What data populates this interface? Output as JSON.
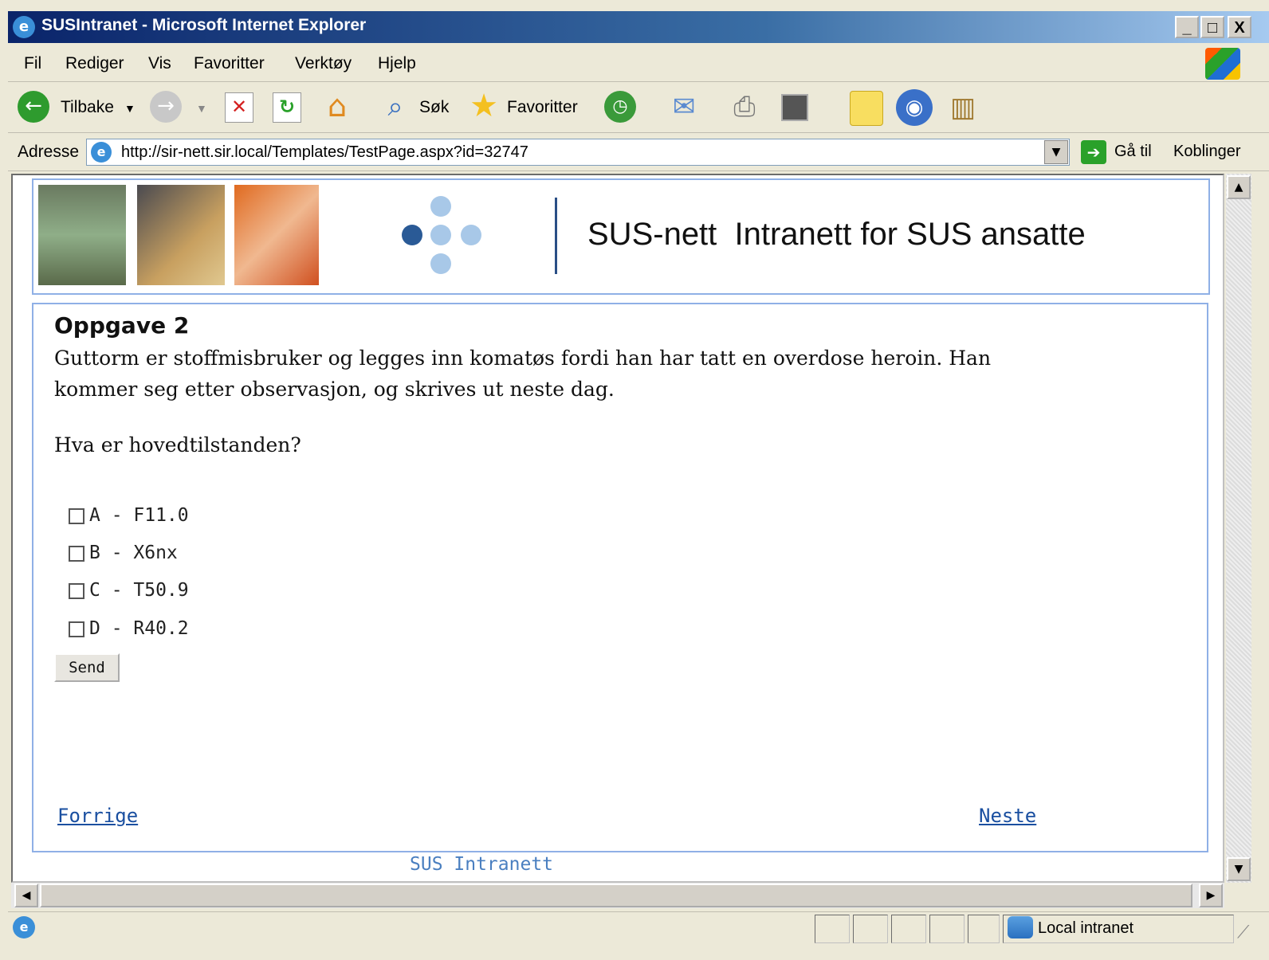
{
  "window": {
    "title": "SUSIntranet - Microsoft Internet Explorer",
    "controls": [
      "_",
      "□",
      "X"
    ]
  },
  "menu": {
    "items": [
      "Fil",
      "Rediger",
      "Vis",
      "Favoritter",
      "Verktøy",
      "Hjelp"
    ]
  },
  "toolbar": {
    "back_label": "Tilbake",
    "search_label": "Søk",
    "favorites_label": "Favoritter"
  },
  "address": {
    "label": "Adresse",
    "url": "http://sir-nett.sir.local/Templates/TestPage.aspx?id=32747",
    "go_label": "Gå til",
    "links_label": "Koblinger"
  },
  "page": {
    "site_title": "SUS-nett  Intranett for SUS ansatte",
    "task_title": "Oppgave 2",
    "task_text": "Guttorm er stoffmisbruker og legges inn komatøs fordi han har tatt en overdose heroin. Han kommer seg etter observasjon, og skrives ut neste dag.",
    "question": "Hva er hovedtilstanden?",
    "options": [
      "A - F11.0",
      "B - X6nx",
      "C - T50.9",
      "D - R40.2"
    ],
    "send_label": "Send",
    "prev_label": "Forrige",
    "next_label": "Neste",
    "footer": "SUS Intranett"
  },
  "status": {
    "zone": "Local intranet"
  }
}
